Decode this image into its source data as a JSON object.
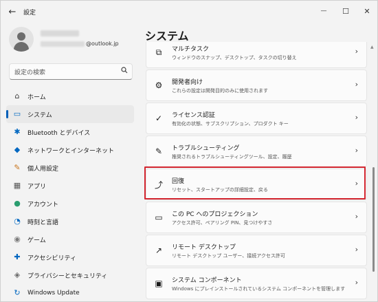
{
  "app": {
    "title": "設定",
    "back_glyph": "←",
    "controls": {
      "minimize": "—",
      "maximize": "☐",
      "close": "✕"
    }
  },
  "profile": {
    "email_domain": "@outlook.jp"
  },
  "search": {
    "placeholder": "設定の検索",
    "icon": "search-icon"
  },
  "nav": {
    "items": [
      {
        "label": "ホーム",
        "icon": "home-icon",
        "glyph": "⌂",
        "color": "#3b3b3b"
      },
      {
        "label": "システム",
        "icon": "system-icon",
        "glyph": "▭",
        "color": "#0067c0",
        "selected": true
      },
      {
        "label": "Bluetooth とデバイス",
        "icon": "bluetooth-icon",
        "glyph": "✱",
        "color": "#0067c0"
      },
      {
        "label": "ネットワークとインターネット",
        "icon": "wifi-icon",
        "glyph": "◆",
        "color": "#0067c0"
      },
      {
        "label": "個人用設定",
        "icon": "brush-icon",
        "glyph": "✎",
        "color": "#c8741c"
      },
      {
        "label": "アプリ",
        "icon": "apps-icon",
        "glyph": "▦",
        "color": "#555555"
      },
      {
        "label": "アカウント",
        "icon": "account-icon",
        "glyph": "●",
        "color": "#2a9d6f"
      },
      {
        "label": "時刻と言語",
        "icon": "globe-clock-icon",
        "glyph": "◔",
        "color": "#0067c0"
      },
      {
        "label": "ゲーム",
        "icon": "gamepad-icon",
        "glyph": "◉",
        "color": "#7a7a7a"
      },
      {
        "label": "アクセシビリティ",
        "icon": "accessibility-icon",
        "glyph": "✚",
        "color": "#0067c0"
      },
      {
        "label": "プライバシーとセキュリティ",
        "icon": "shield-icon",
        "glyph": "◈",
        "color": "#6b6b6b"
      },
      {
        "label": "Windows Update",
        "icon": "update-icon",
        "glyph": "↻",
        "color": "#0067c0"
      }
    ]
  },
  "main": {
    "title": "システム",
    "items": [
      {
        "title": "マルチタスク",
        "desc": "ウィンドウのスナップ、デスクトップ、タスクの切り替え",
        "icon": "multitasking-icon",
        "glyph": "⧉"
      },
      {
        "title": "開発者向け",
        "desc": "これらの設定は開発目的のみに使用されます",
        "icon": "developer-icon",
        "glyph": "⚙"
      },
      {
        "title": "ライセンス認証",
        "desc": "有効化の状態、サブスクリプション、プロダクト キー",
        "icon": "activation-icon",
        "glyph": "✓"
      },
      {
        "title": "トラブルシューティング",
        "desc": "推奨されるトラブルシューティングツール、設定、履歴",
        "icon": "wrench-icon",
        "glyph": "✎"
      },
      {
        "title": "回復",
        "desc": "リセット、スタートアップの詳細設定、戻る",
        "icon": "recovery-icon",
        "glyph": "⤴",
        "highlighted": true
      },
      {
        "title": "この PC へのプロジェクション",
        "desc": "アクセス許可、ペアリング PIN、見つけやすさ",
        "icon": "projection-icon",
        "glyph": "▭"
      },
      {
        "title": "リモート デスクトップ",
        "desc": "リモート デスクトップ ユーザー、接続アクセス許可",
        "icon": "remote-desktop-icon",
        "glyph": "↗"
      },
      {
        "title": "システム コンポーネント",
        "desc": "Windows にプレインストールされているシステム コンポーネントを管理します",
        "icon": "components-icon",
        "glyph": "▣"
      }
    ],
    "chevron": "›",
    "highlight_color": "#d3252f"
  }
}
